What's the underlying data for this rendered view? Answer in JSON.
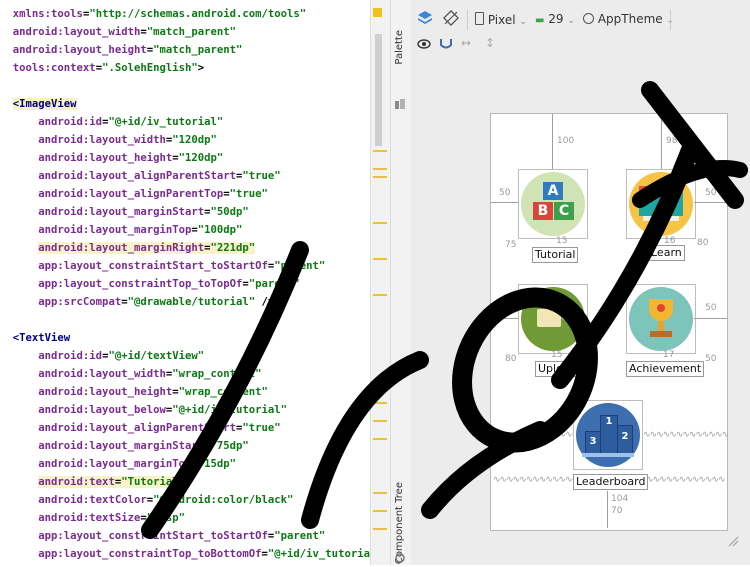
{
  "code": {
    "lines": [
      {
        "attr": "xmlns:tools",
        "val": "\"http://schemas.android.com/tools\""
      },
      {
        "attr": "android:layout_width",
        "val": "\"match_parent\""
      },
      {
        "attr": "android:layout_height",
        "val": "\"match_parent\""
      },
      {
        "attr": "tools:context",
        "val": "\".SolehEnglish\"",
        "end": ">"
      },
      {
        "blank": true
      },
      {
        "tag": "<ImageView",
        "hl": true
      },
      {
        "attr": "android:id",
        "val": "\"@+id/iv_tutorial\""
      },
      {
        "attr": "android:layout_width",
        "val": "\"120dp\""
      },
      {
        "attr": "android:layout_height",
        "val": "\"120dp\""
      },
      {
        "attr": "android:layout_alignParentStart",
        "val": "\"true\""
      },
      {
        "attr": "android:layout_alignParentTop",
        "val": "\"true\""
      },
      {
        "attr": "android:layout_marginStart",
        "val": "\"50dp\""
      },
      {
        "attr": "android:layout_marginTop",
        "val": "\"100dp\""
      },
      {
        "attr": "android:layout_marginRight",
        "val": "\"221dp\"",
        "hl": true
      },
      {
        "attr": "app:layout_constraintStart_toStartOf",
        "val": "\"parent\""
      },
      {
        "attr": "app:layout_constraintTop_toTopOf",
        "val": "\"parent\""
      },
      {
        "attr": "app:srcCompat",
        "val": "\"@drawable/tutorial\"",
        "end": " />"
      },
      {
        "blank": true
      },
      {
        "tag": "<TextView"
      },
      {
        "attr": "android:id",
        "val": "\"@+id/textView\""
      },
      {
        "attr": "android:layout_width",
        "val": "\"wrap_content\""
      },
      {
        "attr": "android:layout_height",
        "val": "\"wrap_content\""
      },
      {
        "attr": "android:layout_below",
        "val": "\"@+id/iv_tutorial\""
      },
      {
        "attr": "android:layout_alignParentStart",
        "val": "\"true\""
      },
      {
        "attr": "android:layout_marginStart",
        "val": "\"75dp\""
      },
      {
        "attr": "android:layout_marginTop",
        "val": "\"15dp\""
      },
      {
        "attr": "android:text",
        "val": "\"Tutorial\"",
        "hl": true
      },
      {
        "attr": "android:textColor",
        "val": "\"@android:color/black\""
      },
      {
        "attr": "android:textSize",
        "val": "\"20sp\""
      },
      {
        "attr": "app:layout_constraintStart_toStartOf",
        "val": "\"parent\""
      },
      {
        "attr": "app:layout_constraintTop_toBottomOf",
        "val": "\"@+id/iv_tutoria"
      }
    ]
  },
  "sidebar": {
    "palette": "Palette",
    "component_tree": "Component Tree"
  },
  "toolbar": {
    "device": "Pixel",
    "api": "29",
    "theme": "AppTheme"
  },
  "labels": {
    "tutorial": "Tutorial",
    "learn": "Learn",
    "upload": "Upload",
    "achievement": "Achievement",
    "leaderboard": "Leaderboard"
  },
  "margins": {
    "top_left": "100",
    "top_right": "98",
    "left_r1": "50",
    "right_r1": "50",
    "below_tut_left": "75",
    "below_tut_a": "15",
    "below_tut_b": "55",
    "below_learn_a": "16",
    "below_learn_b": "80",
    "left_r2": "50",
    "right_r2": "50",
    "below_up_left": "80",
    "below_up": "15",
    "below_ach": "17",
    "right_r3": "50",
    "bottom_a": "104",
    "bottom_b": "70"
  },
  "icons": {
    "tutorial_letters": [
      "A",
      "B",
      "C"
    ],
    "podium": [
      "1",
      "2",
      "3"
    ]
  },
  "colors": {
    "attr": "#7a2a92",
    "value": "#0a7a12",
    "tag": "#000080",
    "highlight": "#f7f2c7",
    "warn": "#e7c23a"
  }
}
